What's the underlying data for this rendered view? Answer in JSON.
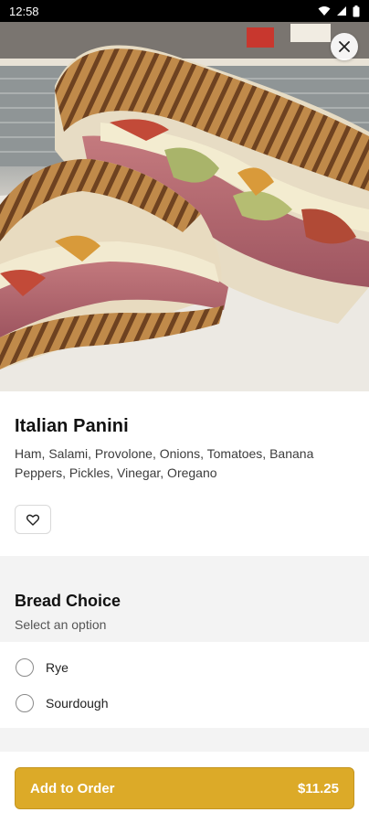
{
  "status_bar": {
    "time": "12:58",
    "icons": [
      "wifi-icon",
      "signal-icon",
      "battery-icon"
    ]
  },
  "hero": {
    "image_subject": "grilled panini sandwich with ham, cheese and vegetables",
    "close_icon": "close-icon"
  },
  "item": {
    "title": "Italian Panini",
    "description": "Ham, Salami, Provolone, Onions, Tomatoes, Banana Peppers, Pickles, Vinegar, Oregano",
    "favorite_icon": "heart-outline-icon"
  },
  "options": {
    "title": "Bread Choice",
    "subtitle": "Select an option",
    "choices": [
      {
        "label": "Rye",
        "selected": false
      },
      {
        "label": "Sourdough",
        "selected": false
      }
    ]
  },
  "footer": {
    "add_label": "Add to Order",
    "price": "$11.25"
  },
  "colors": {
    "accent": "#DCAA28",
    "section_bg": "#F3F3F3"
  }
}
